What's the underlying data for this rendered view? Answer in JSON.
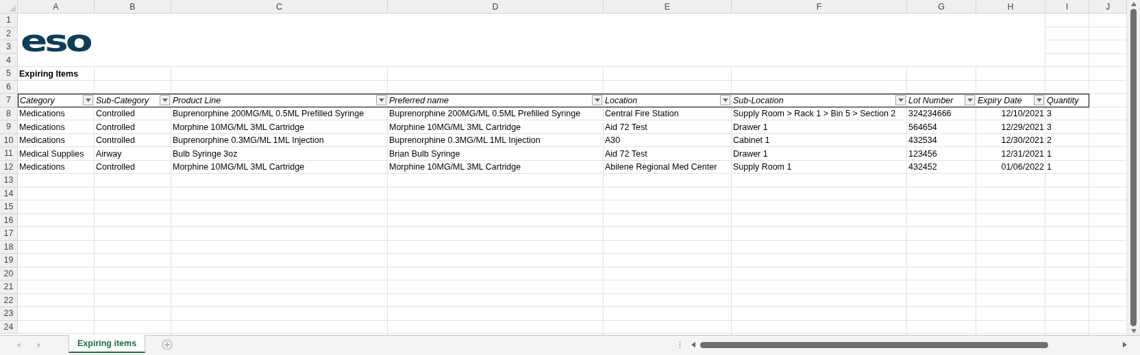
{
  "column_headers": [
    "A",
    "B",
    "C",
    "D",
    "E",
    "F",
    "G",
    "H",
    "I",
    "J"
  ],
  "row_numbers": [
    "1",
    "2",
    "3",
    "4",
    "5",
    "6",
    "7",
    "8",
    "9",
    "10",
    "11",
    "12",
    "13",
    "14",
    "15",
    "16",
    "17",
    "18",
    "19",
    "20",
    "21",
    "22",
    "23",
    "24"
  ],
  "logo": "eso",
  "title": "Expiring Items",
  "table": {
    "columns": [
      {
        "label": "Category",
        "filter": true,
        "kind": "text"
      },
      {
        "label": "Sub-Category",
        "filter": true,
        "kind": "text"
      },
      {
        "label": "Product Line",
        "filter": true,
        "kind": "text"
      },
      {
        "label": "Preferred name",
        "filter": true,
        "kind": "text"
      },
      {
        "label": "Location",
        "filter": true,
        "kind": "text"
      },
      {
        "label": "Sub-Location",
        "filter": true,
        "kind": "text"
      },
      {
        "label": "Lot Number",
        "filter": true,
        "kind": "text"
      },
      {
        "label": "Expiry Date",
        "filter": true,
        "kind": "date"
      },
      {
        "label": "Quantity",
        "filter": false,
        "kind": "text"
      }
    ],
    "rows": [
      [
        "Medications",
        "Controlled",
        "Buprenorphine 200MG/ML 0.5ML Prefilled Syringe",
        "Buprenorphine 200MG/ML 0.5ML Prefilled Syringe",
        "Central Fire Station",
        "Supply Room > Rack 1 > Bin 5 > Section 2",
        "324234666",
        "12/10/2021",
        "3"
      ],
      [
        "Medications",
        "Controlled",
        "Morphine 10MG/ML 3ML Cartridge",
        "Morphine 10MG/ML 3ML Cartridge",
        "Aid 72 Test",
        "Drawer 1",
        "564654",
        "12/29/2021",
        "3"
      ],
      [
        "Medications",
        "Controlled",
        "Buprenorphine 0.3MG/ML 1ML Injection",
        "Buprenorphine 0.3MG/ML 1ML Injection",
        "A30",
        "Cabinet 1",
        "432534",
        "12/30/2021",
        "2"
      ],
      [
        "Medical Supplies",
        "Airway",
        "Bulb Syringe 3oz",
        "Brian Bulb Syringe",
        "Aid 72 Test",
        "Drawer 1",
        "123456",
        "12/31/2021",
        "1"
      ],
      [
        "Medications",
        "Controlled",
        "Morphine 10MG/ML 3ML Cartridge",
        "Morphine 10MG/ML 3ML Cartridge",
        "Abilene Regional Med Center",
        "Supply Room 1",
        "432452",
        "01/06/2022",
        "1"
      ]
    ]
  },
  "sheet_tabs": [
    {
      "label": "Expiring items",
      "selected": true
    }
  ]
}
